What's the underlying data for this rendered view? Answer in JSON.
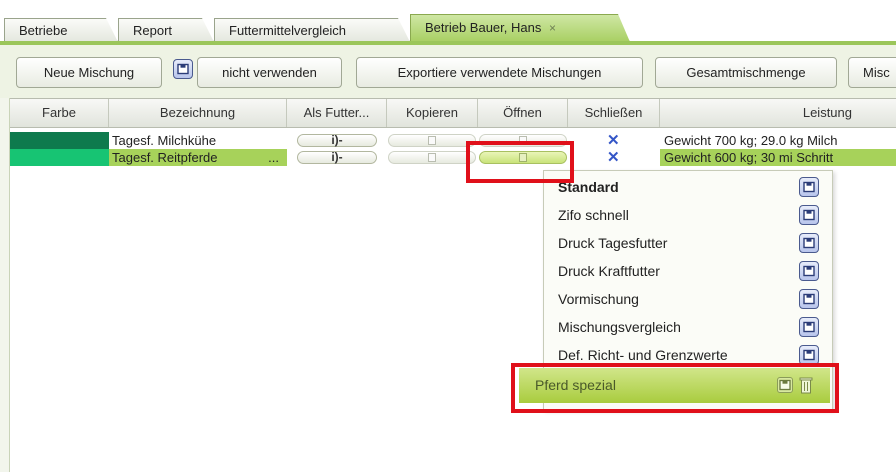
{
  "tabs": [
    {
      "label": "Betriebe"
    },
    {
      "label": "Report"
    },
    {
      "label": "Futtermittelvergleich"
    },
    {
      "label": "Betrieb Bauer, Hans",
      "close": "×",
      "active": true
    }
  ],
  "toolbar": {
    "new_mix": "Neue Mischung",
    "not_use": "nicht verwenden",
    "export": "Exportiere verwendete Mischungen",
    "total": "Gesamtmischmenge",
    "more": "Misc"
  },
  "columns": [
    "Farbe",
    "Bezeichnung",
    "Als Futter...",
    "Kopieren",
    "Öffnen",
    "Schließen",
    "Leistung"
  ],
  "rows": [
    {
      "color": "#0e7a4d",
      "name": "Tagesf. Milchkühe",
      "suffix": "",
      "leistung": "Gewicht  700 kg; 29.0 kg Milch"
    },
    {
      "color": "#17c473",
      "name": "Tagesf. Reitpferde",
      "suffix": "...",
      "leistung": "Gewicht  600 kg; 30 mi Schritt",
      "selected": true
    }
  ],
  "menu": {
    "items": [
      {
        "label": "Standard",
        "bold": true
      },
      {
        "label": "Zifo schnell"
      },
      {
        "label": "Druck Tagesfutter"
      },
      {
        "label": "Druck Kraftfutter"
      },
      {
        "label": "Vormischung"
      },
      {
        "label": "Mischungsvergleich"
      },
      {
        "label": "Def. Richt- und Grenzwerte"
      }
    ],
    "highlighted": "Pferd spezial"
  },
  "icons": {
    "close": "close-icon",
    "save": "save-icon",
    "delete": "trash-icon",
    "feed": "feed-icon",
    "copy": "copy-icon",
    "open": "folder-icon"
  },
  "colors": {
    "accent": "#9bc65a",
    "highlight": "#a9cc3e",
    "annotation": "#e0101a"
  }
}
